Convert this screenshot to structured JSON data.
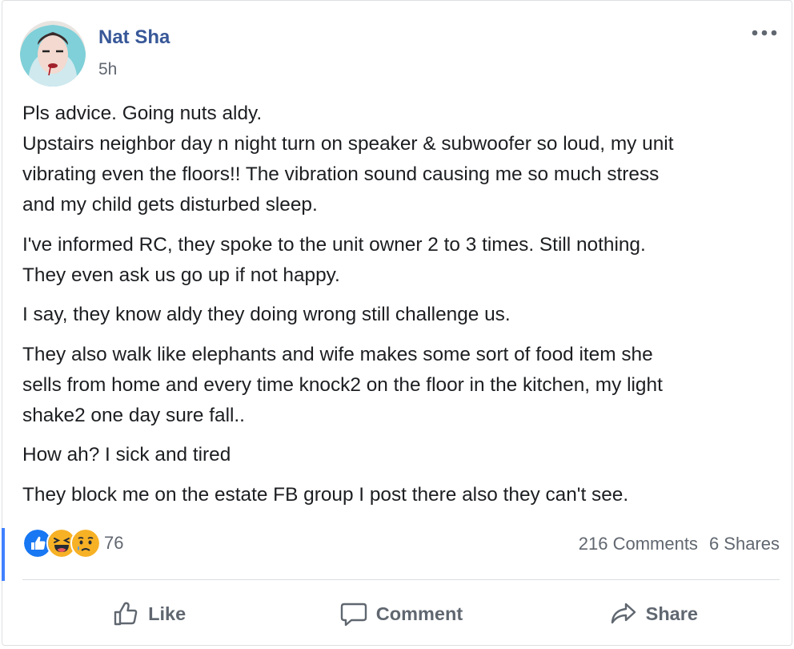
{
  "post": {
    "author": "Nat Sha",
    "timestamp": "5h",
    "paragraphs": [
      [
        "Pls advice. Going nuts aldy.",
        "Upstairs neighbor day n night turn on speaker & subwoofer so loud, my unit",
        "vibrating even the floors!! The vibration sound causing me so much stress",
        "and my child gets disturbed sleep."
      ],
      [
        "I've informed RC, they spoke to the unit owner 2 to 3 times. Still nothing.",
        "They even ask us go up if not happy."
      ],
      [
        "I say, they know aldy they doing wrong still challenge us."
      ],
      [
        "They also walk like elephants and wife makes some sort of food item she",
        "sells from home and every time knock2 on the floor in the kitchen, my light",
        "shake2 one day sure fall.."
      ],
      [
        "How ah? I sick and tired"
      ],
      [
        "They block me on the estate FB group I post there also they can't see."
      ]
    ]
  },
  "reactions": {
    "icons": [
      "like-icon",
      "haha-icon",
      "sad-icon"
    ],
    "count": "76"
  },
  "stats": {
    "comments": "216 Comments",
    "shares": "6 Shares"
  },
  "actions": {
    "like": "Like",
    "comment": "Comment",
    "share": "Share"
  },
  "colors": {
    "author_link": "#385898",
    "secondary_text": "#616770",
    "like_blue": "#1877f2",
    "reaction_yellow": "#f7b125",
    "accent": "#4080ff"
  }
}
